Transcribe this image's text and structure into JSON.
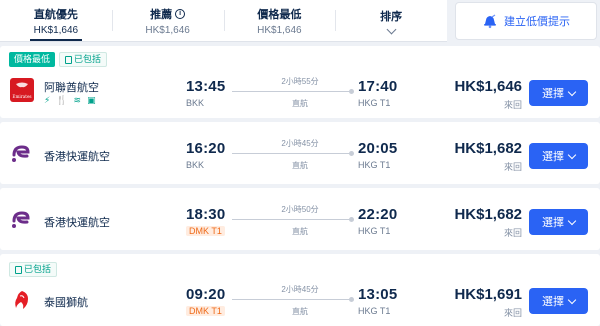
{
  "sort": {
    "tabs": [
      {
        "label": "直航優先",
        "price": "HK$1,646"
      },
      {
        "label": "推薦",
        "price": "HK$1,646"
      },
      {
        "label": "價格最低",
        "price": "HK$1,646"
      },
      {
        "label": "排序",
        "price": ""
      }
    ],
    "alert_label": "建立低價提示"
  },
  "flights": [
    {
      "tags": [
        "價格最低",
        "已包括"
      ],
      "airline": "阿聯酋航空",
      "logo_text": "Emirates",
      "amenity_icons": [
        "power-icon",
        "meal-icon",
        "wifi-icon",
        "entertainment-icon"
      ],
      "dep_time": "13:45",
      "dep_airport": "BKK",
      "duration": "2小時55分",
      "stops": "直航",
      "arr_time": "17:40",
      "arr_airport": "HKG T1",
      "price": "HK$1,646",
      "trip": "來回",
      "button": "選擇"
    },
    {
      "tags": [],
      "airline": "香港快運航空",
      "dep_time": "16:20",
      "dep_airport": "BKK",
      "duration": "2小時45分",
      "stops": "直航",
      "arr_time": "20:05",
      "arr_airport": "HKG T1",
      "price": "HK$1,682",
      "trip": "來回",
      "button": "選擇"
    },
    {
      "tags": [],
      "airline": "香港快運航空",
      "dep_time": "18:30",
      "dep_airport": "DMK T1",
      "duration": "2小時50分",
      "stops": "直航",
      "arr_time": "22:20",
      "arr_airport": "HKG T1",
      "price": "HK$1,682",
      "trip": "來回",
      "button": "選擇"
    },
    {
      "tags": [
        "已包括"
      ],
      "airline": "泰國獅航",
      "dep_time": "09:20",
      "dep_airport": "DMK T1",
      "duration": "2小時45分",
      "stops": "直航",
      "arr_time": "13:05",
      "arr_airport": "HKG T1",
      "price": "HK$1,691",
      "trip": "來回",
      "button": "選擇"
    }
  ],
  "colors": {
    "accent": "#2a63f4",
    "text": "#0f294d",
    "green": "#00b89f",
    "warn": "#ef6b1a"
  }
}
